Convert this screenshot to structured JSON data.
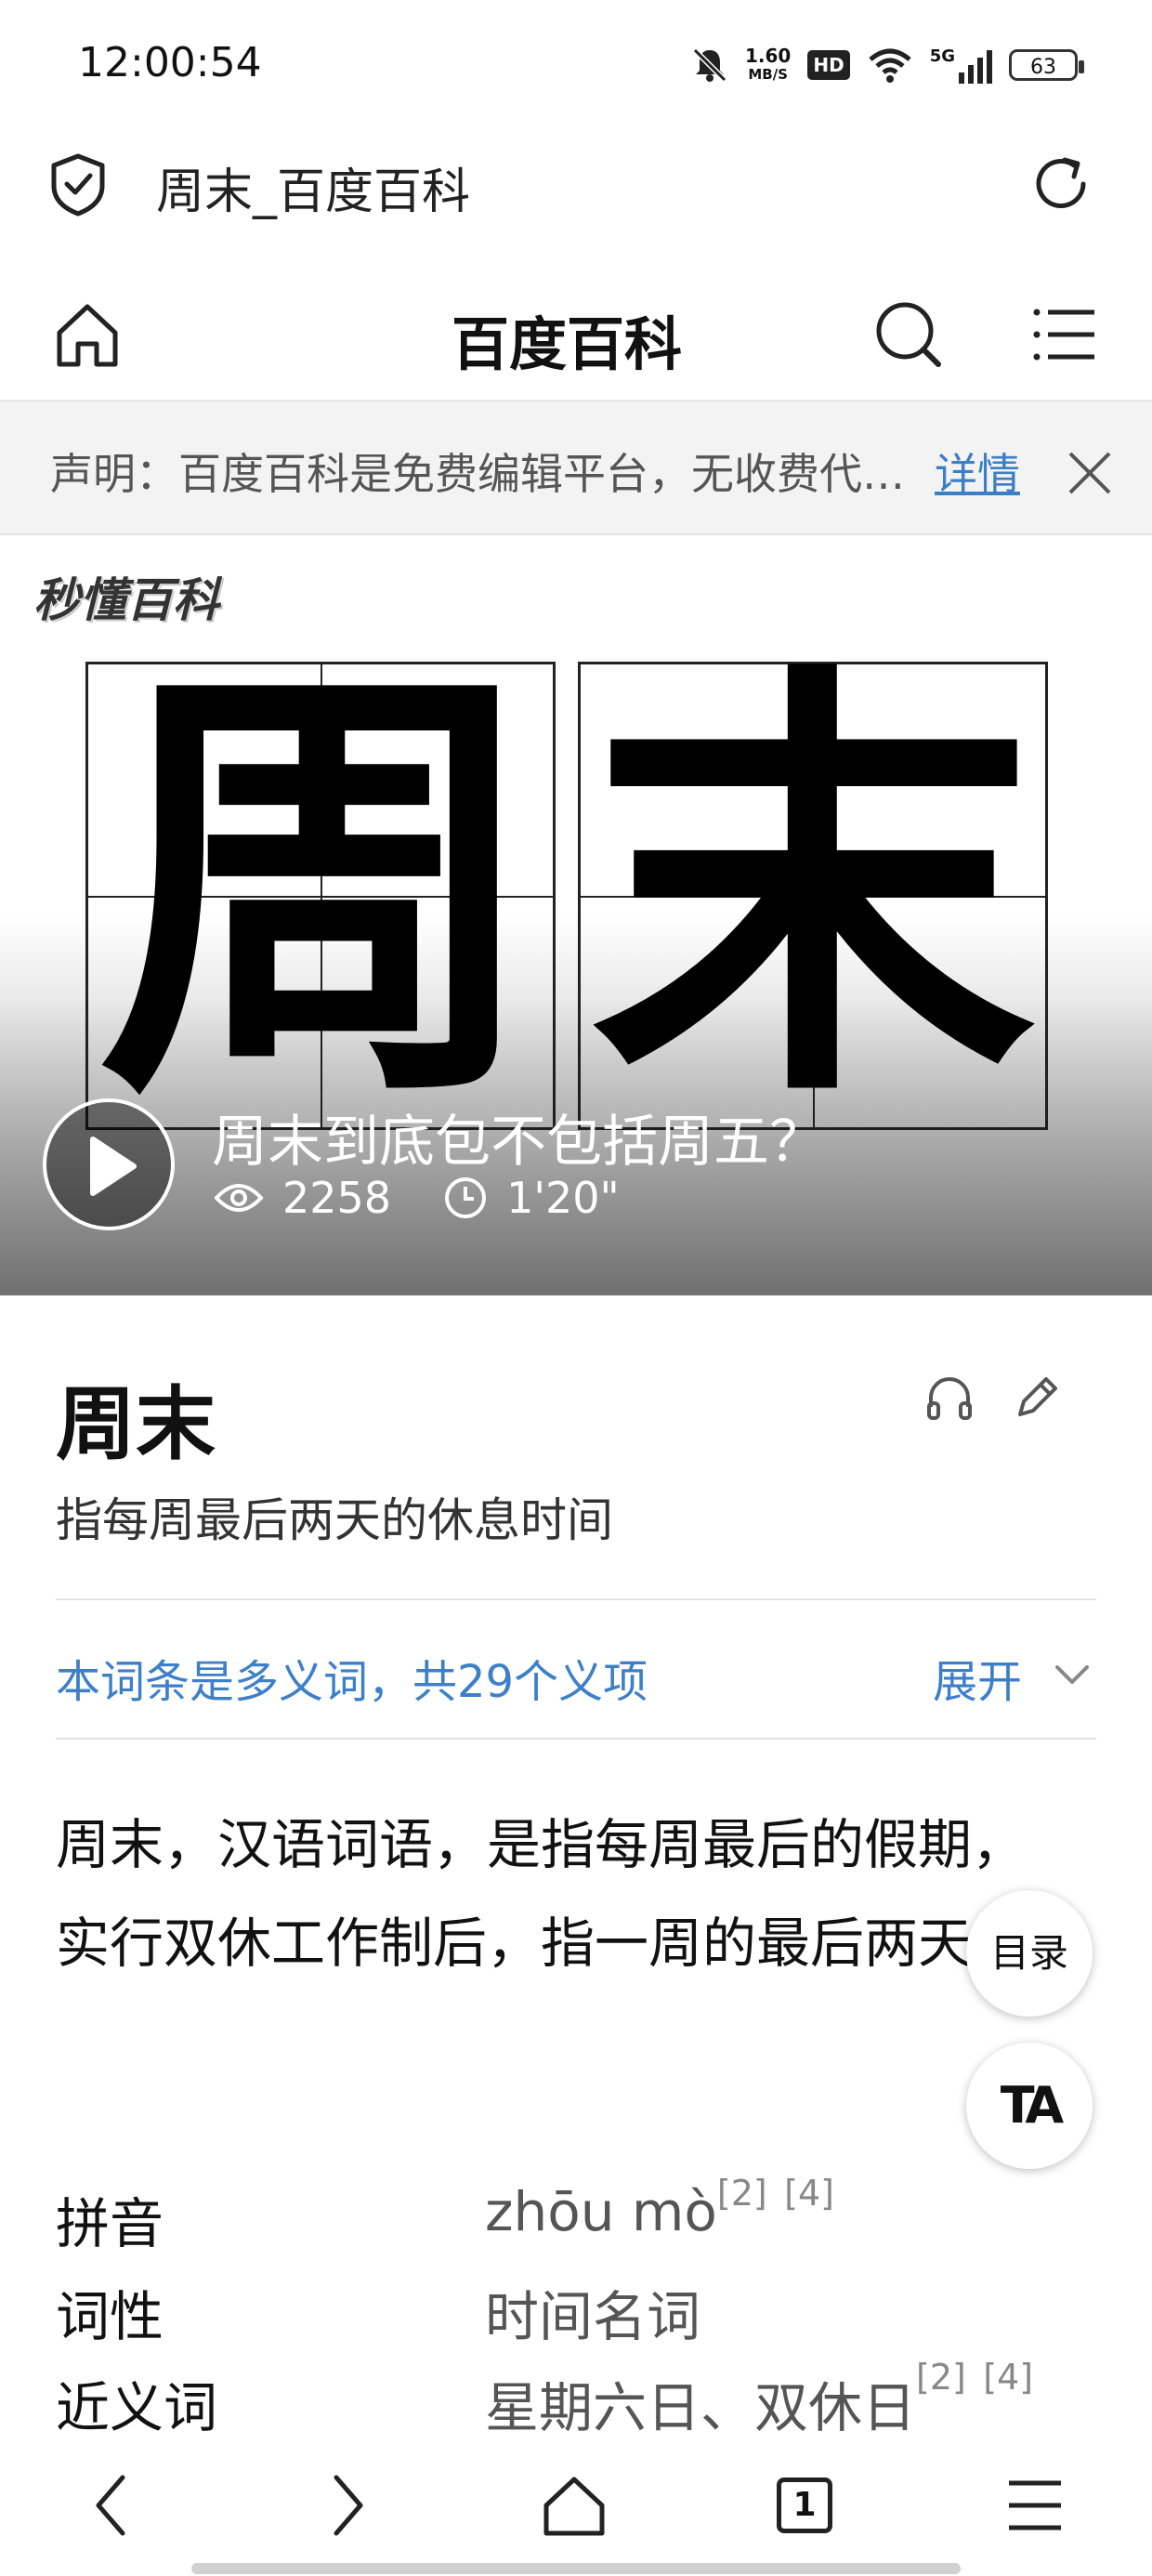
{
  "status_bar": {
    "time": "12:00:54",
    "net_speed_value": "1.60",
    "net_speed_unit": "MB/S",
    "hd_label": "HD",
    "network": "5G",
    "battery": "63"
  },
  "url_bar": {
    "title": "周末_百度百科"
  },
  "header": {
    "title": "百度百科"
  },
  "notice": {
    "text": "声明：百度百科是免费编辑平台，无收费代编服务",
    "link": "详情"
  },
  "video": {
    "logo": "秒懂百科",
    "char_1": "周",
    "char_2": "末",
    "title": "周末到底包不包括周五？",
    "views": "2258",
    "duration": "1'20\""
  },
  "entry": {
    "title": "周末",
    "subtitle": "指每周最后两天的休息时间",
    "polysemy": "本词条是多义词，共29个义项",
    "expand": "展开",
    "summary": "周末，汉语词语，是指每周最后的假期，实行双休工作制后，指一周的最后两天。"
  },
  "floating": {
    "toc": "目录",
    "font": "TA"
  },
  "info": [
    {
      "key": "拼音",
      "value": "zhōu mò",
      "refs": [
        "[2]",
        "[4]"
      ]
    },
    {
      "key": "词性",
      "value": "时间名词",
      "refs": []
    },
    {
      "key": "近义词",
      "value": "星期六日、双休日",
      "refs": [
        "[2]",
        "[4]"
      ]
    }
  ],
  "bottom_nav": {
    "tab_count": "1"
  },
  "colors": {
    "link_blue": "#3d7fc9",
    "notice_bg": "#f3f3f3"
  }
}
